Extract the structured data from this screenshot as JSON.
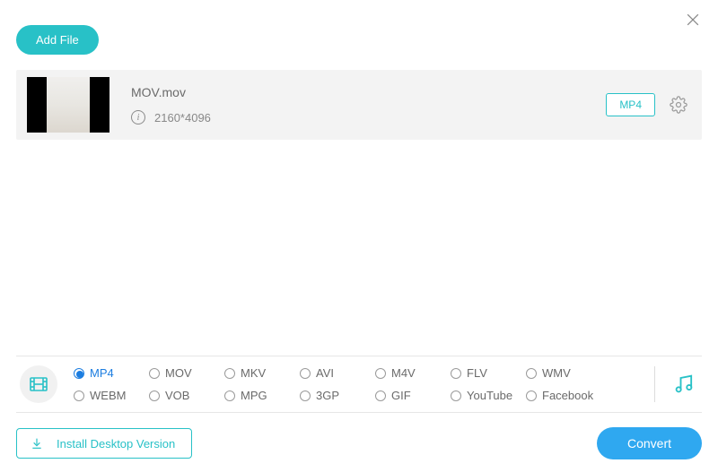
{
  "header": {
    "add_file_label": "Add File"
  },
  "file": {
    "name": "MOV.mov",
    "resolution": "2160*4096",
    "output_format": "MP4"
  },
  "formats": {
    "selected": "MP4",
    "row1": [
      "MP4",
      "MOV",
      "MKV",
      "AVI",
      "M4V",
      "FLV",
      "WMV"
    ],
    "row2": [
      "WEBM",
      "VOB",
      "MPG",
      "3GP",
      "GIF",
      "YouTube",
      "Facebook"
    ]
  },
  "footer": {
    "install_label": "Install Desktop Version",
    "convert_label": "Convert"
  }
}
